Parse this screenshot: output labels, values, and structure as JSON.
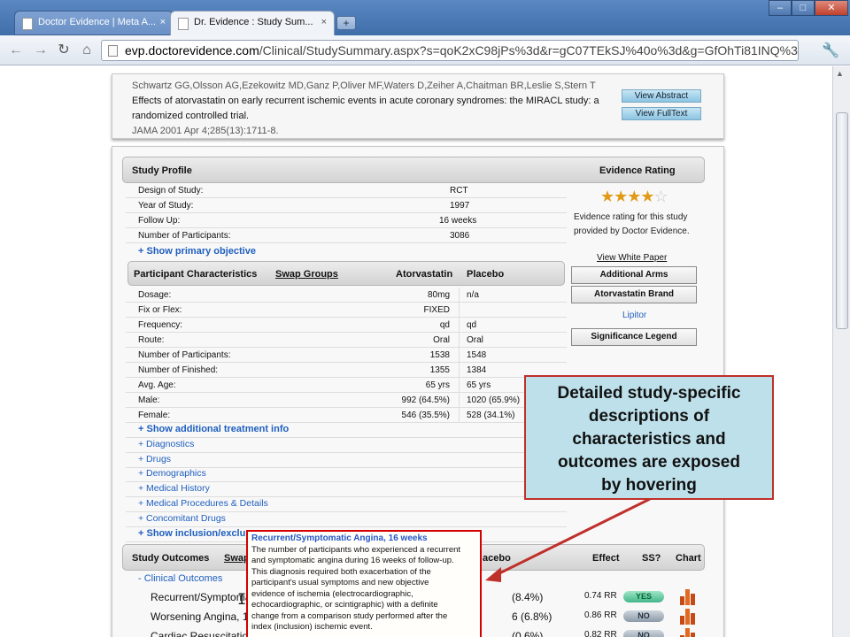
{
  "browser": {
    "tabs": [
      {
        "label": "Doctor Evidence | Meta A...",
        "close": "×"
      },
      {
        "label": "Dr. Evidence : Study Sum...",
        "close": "×"
      }
    ],
    "new_tab": "+",
    "window_controls": {
      "minimize": "–",
      "maximize": "□",
      "close": "✕"
    },
    "nav": {
      "back": "←",
      "forward": "→",
      "reload": "↻",
      "home": "⌂"
    },
    "url_host": "evp.doctorevidence.com",
    "url_path": "/Clinical/StudySummary.aspx?s=qoK2xC98jPs%3d&r=gC07TEkSJ%40o%3d&g=GfOhTi81INQ%3d&",
    "wrench": "🔧"
  },
  "citation": {
    "authors": "Schwartz GG,Olsson AG,Ezekowitz MD,Ganz P,Oliver MF,Waters D,Zeiher A,Chaitman BR,Leslie S,Stern T",
    "title_line1": "Effects of atorvastatin on early recurrent ischemic events in acute coronary syndromes: the MIRACL study: a",
    "title_line2": "randomized controlled trial.",
    "journal": "JAMA 2001 Apr 4;285(13):1711-8.",
    "view_abstract": "View Abstract",
    "view_fulltext": "View FullText"
  },
  "study_profile": {
    "header": "Study Profile",
    "evidence_rating_header": "Evidence Rating",
    "rows": [
      {
        "label": "Design of Study:",
        "value": "RCT"
      },
      {
        "label": "Year of Study:",
        "value": "1997"
      },
      {
        "label": "Follow Up:",
        "value": "16 weeks"
      },
      {
        "label": "Number of Participants:",
        "value": "3086"
      }
    ],
    "show_primary_objective": "+ Show primary objective"
  },
  "evidence": {
    "stars": "★★★★",
    "star_empty": "☆",
    "description_line1": "Evidence rating for this study",
    "description_line2": "provided by Doctor Evidence.",
    "view_white_paper": "View White Paper",
    "additional_arms": "Additional Arms",
    "atorvastatin_brand": "Atorvastatin Brand",
    "lipitor": "Lipitor",
    "significance_legend": "Significance Legend"
  },
  "participant_characteristics": {
    "header": "Participant Characteristics",
    "swap_groups": "Swap Groups",
    "col1": "Atorvastatin",
    "col2": "Placebo",
    "rows": [
      {
        "label": "Dosage:",
        "a": "80mg",
        "b": "n/a"
      },
      {
        "label": "Fix or Flex:",
        "a": "FIXED",
        "b": ""
      },
      {
        "label": "Frequency:",
        "a": "qd",
        "b": "qd"
      },
      {
        "label": "Route:",
        "a": "Oral",
        "b": "Oral"
      },
      {
        "label": "Number of Participants:",
        "a": "1538",
        "b": "1548"
      },
      {
        "label": "Number of Finished:",
        "a": "1355",
        "b": "1384"
      },
      {
        "label": "Avg. Age:",
        "a": "65 yrs",
        "b": "65 yrs"
      },
      {
        "label": "Male:",
        "a": "992 (64.5%)",
        "b": "1020 (65.9%)"
      },
      {
        "label": "Female:",
        "a": "546 (35.5%)",
        "b": "528 (34.1%)"
      }
    ],
    "expanders": [
      "+ Show additional treatment info",
      "+ Diagnostics",
      "+ Drugs",
      "+ Demographics",
      "+ Medical History",
      "+ Medical Procedures & Details",
      "+ Concomitant Drugs",
      "+ Show inclusion/exclu"
    ]
  },
  "outcomes": {
    "header": "Study Outcomes",
    "swap": "Swap",
    "placebo": "acebo",
    "effect": "Effect",
    "ss": "SS?",
    "chart": "Chart",
    "group": "- Clinical Outcomes",
    "rows": [
      {
        "name": "Recurrent/Symptoma",
        "value": "(8.4%)",
        "effect": "0.74 RR",
        "ss": "YES"
      },
      {
        "name": "Worsening Angina, 16",
        "value": "6 (6.8%)",
        "effect": "0.86 RR",
        "ss": "NO"
      },
      {
        "name": "Cardiac Resuscitatio",
        "value": "(0.6%)",
        "effect": "0.82 RR",
        "ss": "NO"
      }
    ]
  },
  "tooltip": {
    "title": "Recurrent/Symptomatic Angina, 16 weeks",
    "lines": [
      "The number of participants who experienced a recurrent",
      "and symptomatic angina during 16 weeks of follow-up.",
      "This diagnosis required both exacerbation of the",
      "participant's usual symptoms and new objective",
      "evidence of ischemia (electrocardiographic,",
      "echocardiographic, or scintigraphic) with a definite",
      "change from a comparison study performed after the",
      "index (inclusion) ischemic event."
    ]
  },
  "callout": {
    "lines": [
      "Detailed study-specific",
      "descriptions of",
      "characteristics and",
      "outcomes are exposed",
      "by hovering"
    ]
  },
  "cursor": "I",
  "colors": {
    "accent_link": "#1f5fbf",
    "callout_bg": "#bde0ea",
    "callout_border": "#c0302a",
    "yes_pill": "#43b58b",
    "no_pill": "#8c9aa8",
    "star": "#e09a15"
  }
}
